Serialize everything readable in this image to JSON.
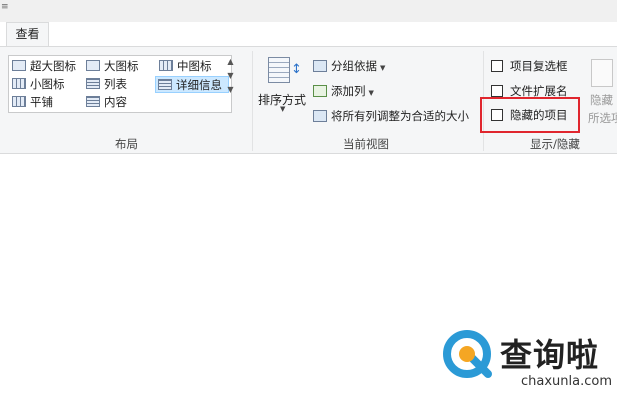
{
  "window": {
    "edge_mark": "≡"
  },
  "tabs": {
    "active_label": "查看"
  },
  "layout_group": {
    "label": "布局",
    "items": [
      {
        "label": "超大图标",
        "icon": "extra-large-icons-icon"
      },
      {
        "label": "大图标",
        "icon": "large-icons-icon"
      },
      {
        "label": "中图标",
        "icon": "medium-icons-icon"
      },
      {
        "label": "小图标",
        "icon": "small-icons-icon"
      },
      {
        "label": "列表",
        "icon": "list-icon"
      },
      {
        "label": "详细信息",
        "icon": "details-icon",
        "selected": true
      },
      {
        "label": "平铺",
        "icon": "tiles-icon"
      },
      {
        "label": "内容",
        "icon": "content-icon"
      }
    ]
  },
  "current_view_group": {
    "label": "当前视图",
    "sort_by": "排序方式",
    "group_by": "分组依据",
    "add_column": "添加列",
    "size_columns": "将所有列调整为合适的大小"
  },
  "show_hide_group": {
    "label": "显示/隐藏",
    "item_checkboxes": "项目复选框",
    "file_extensions": "文件扩展名",
    "hidden_items": "隐藏的项目",
    "hide_selected_1": "隐藏",
    "hide_selected_2": "所选项目"
  },
  "watermark": {
    "title": "查询啦",
    "url": "chaxunla.com",
    "brand_color": "#2b9ad6",
    "accent_color": "#f5a623"
  },
  "colors": {
    "highlight_border": "#e0262e",
    "selected_bg": "#cce8ff"
  }
}
